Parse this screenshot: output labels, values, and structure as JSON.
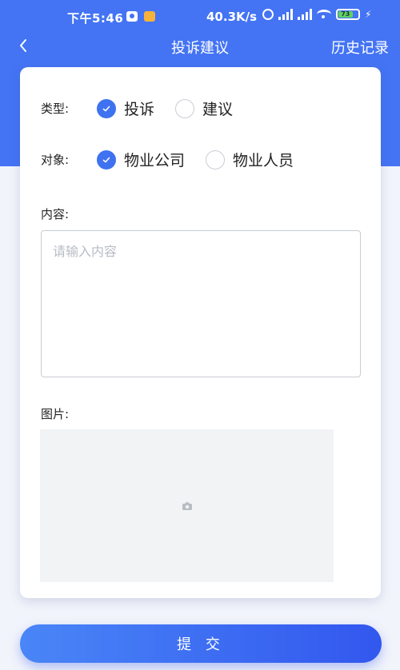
{
  "status_bar": {
    "time": "下午5:46",
    "network_speed": "40.3K/s",
    "battery_level": "73"
  },
  "nav": {
    "title": "投诉建议",
    "history_label": "历史记录"
  },
  "form": {
    "type": {
      "label": "类型:",
      "options": [
        {
          "label": "投诉",
          "checked": true
        },
        {
          "label": "建议",
          "checked": false
        }
      ]
    },
    "target": {
      "label": "对象:",
      "options": [
        {
          "label": "物业公司",
          "checked": true
        },
        {
          "label": "物业人员",
          "checked": false
        }
      ]
    },
    "content": {
      "label": "内容:",
      "placeholder": "请输入内容",
      "value": ""
    },
    "image": {
      "label": "图片:",
      "icon": "camera-icon"
    }
  },
  "submit_label": "提 交",
  "colors": {
    "primary": "#4474f4",
    "radio_checked": "#3e72f0",
    "page_bg": "#f2f4fb"
  }
}
